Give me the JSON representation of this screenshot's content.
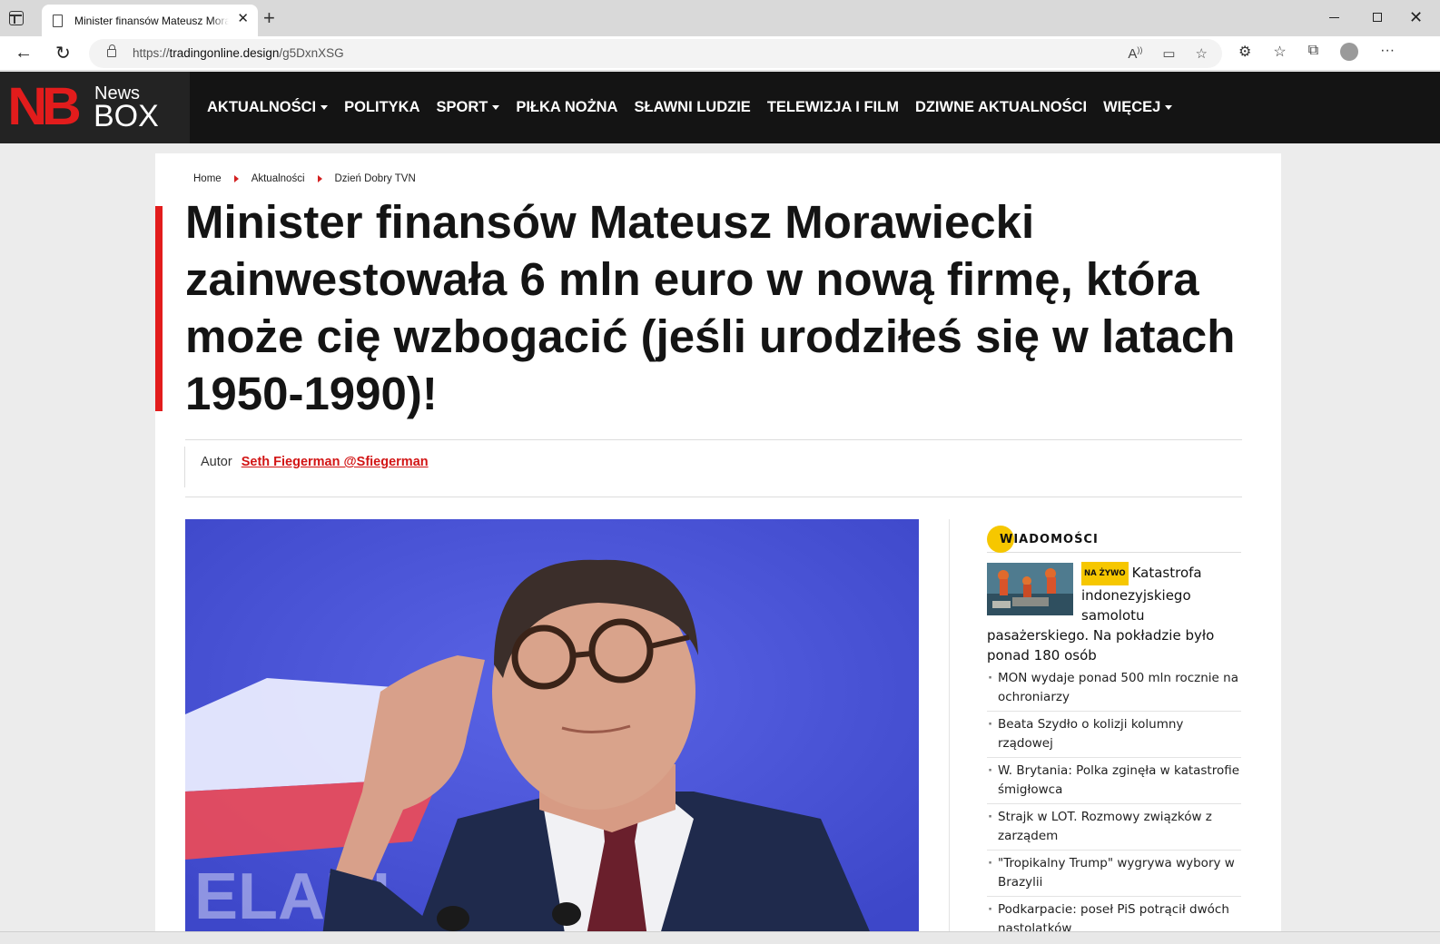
{
  "browser": {
    "tab_title": "Minister finansów Mateusz Morawiecki",
    "tab_close": "✕",
    "new_tab": "+",
    "url_prefix": "https://",
    "url_host": "tradingonline.design",
    "url_path": "/g5DxnXSG"
  },
  "site": {
    "logo_mark": "NB",
    "logo_news": "News",
    "logo_box": "BOX",
    "nav": [
      {
        "label": "AKTUALNOŚCI",
        "dropdown": true
      },
      {
        "label": "POLITYKA",
        "dropdown": false
      },
      {
        "label": "SPORT",
        "dropdown": true
      },
      {
        "label": "PIŁKA NOŻNA",
        "dropdown": false
      },
      {
        "label": "SŁAWNI LUDZIE",
        "dropdown": false
      },
      {
        "label": "TELEWIZJA I FILM",
        "dropdown": false
      },
      {
        "label": "DZIWNE AKTUALNOŚCI",
        "dropdown": false
      },
      {
        "label": "WIĘCEJ",
        "dropdown": true
      }
    ]
  },
  "article": {
    "breadcrumb": [
      "Home",
      "Aktualności",
      "Dzień Dobry TVN"
    ],
    "headline": "Minister finansów Mateusz Morawiecki zainwestowała 6 mln euro w nową firmę, która może cię wzbogacić (jeśli urodziłeś się w latach 1950-1990)!",
    "author_label": "Autor",
    "author_name": "Seth Fiegerman @Sfiegerman"
  },
  "sidebar": {
    "section_title": "WIADOMOŚCI",
    "featured_badge": "NA ŻYWO",
    "featured_title": "Katastrofa indonezyjskiego samolotu pasażerskiego. Na pokładzie było ponad 180 osób",
    "items": [
      "MON wydaje ponad 500 mln rocznie na ochroniarzy",
      "Beata Szydło o kolizji kolumny rządowej",
      "W. Brytania: Polka zginęła w katastrofie śmigłowca",
      "Strajk w LOT. Rozmowy związków z zarządem",
      "\"Tropikalny Trump\" wygrywa wybory w Brazylii",
      "Podkarpacie: poseł PiS potrącił dwóch nastolatków"
    ]
  },
  "colors": {
    "brand_red": "#e21c1c",
    "accent_yellow": "#f6c700",
    "header_bg": "#141414"
  }
}
